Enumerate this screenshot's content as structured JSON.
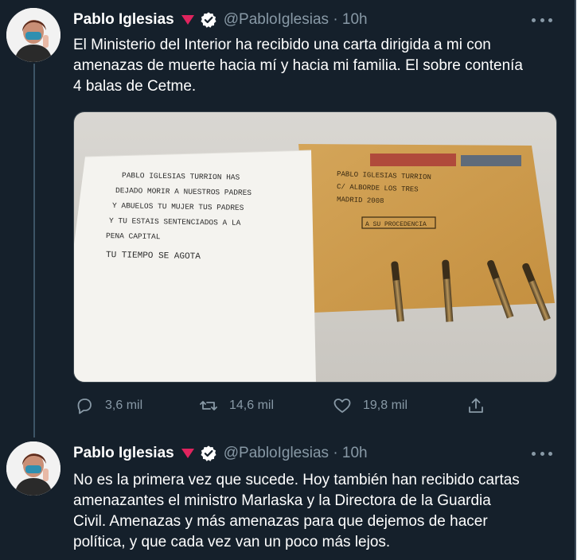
{
  "tweets": [
    {
      "author_name": "Pablo Iglesias",
      "handle_time": "@PabloIglesias · 10h",
      "text_lines": [
        "El Ministerio del Interior ha recibido una carta dirigida a mi con",
        "amenazas de muerte hacia mí y hacia mi familia. El sobre contenía",
        "4 balas de Cetme."
      ],
      "media": {
        "letter_lines": [
          "PABLO IGLESIAS TURRION HAS",
          "DEJADO MORIR A NUESTROS PADRES",
          "Y ABUELOS TU MUJER TUS PADRES",
          "Y TU ESTAIS SENTENCIADOS A LA",
          "PENA CAPITAL",
          "TU TIEMPO SE AGOTA"
        ],
        "envelope_lines": [
          "PABLO IGLESIAS TURRION",
          "C/ ALBORDE LOS TRES",
          "MADRID 2008"
        ],
        "envelope_stamp": "A SU PROCEDENCIA",
        "bullet_count": 4
      },
      "actions": {
        "replies": "3,6 mil",
        "retweets": "14,6 mil",
        "likes": "19,8 mil"
      }
    },
    {
      "author_name": "Pablo Iglesias",
      "handle_time": "@PabloIglesias · 10h",
      "text_lines": [
        "No es la primera vez que sucede. Hoy también han recibido cartas",
        "amenazantes el ministro Marlaska y la Directora de la Guardia",
        "Civil. Amenazas y más amenazas para que dejemos de hacer",
        "política, y que cada vez van un poco más lejos."
      ]
    }
  ],
  "colors": {
    "background": "#15202b",
    "text": "#ffffff",
    "muted": "#8899a6",
    "verified": "#ffffff",
    "pink_triangle": "#e0245e"
  },
  "icons": [
    "reply-icon",
    "retweet-icon",
    "like-icon",
    "share-icon",
    "verified-badge-icon",
    "more-icon"
  ]
}
